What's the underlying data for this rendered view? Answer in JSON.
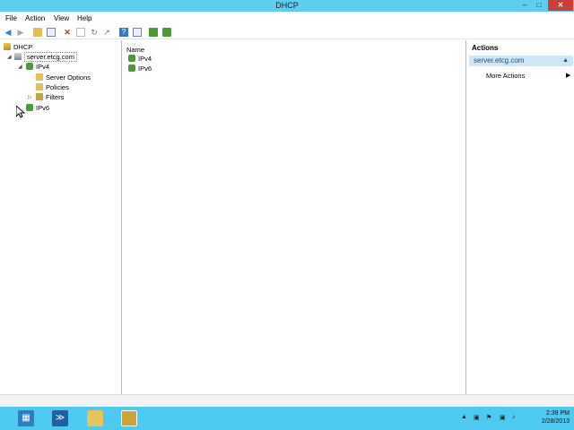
{
  "window": {
    "title": "DHCP",
    "min": "–",
    "max": "□",
    "close": "✕"
  },
  "menu": [
    "File",
    "Action",
    "View",
    "Help"
  ],
  "toolbar": {
    "icons": [
      "back-icon",
      "forward-icon",
      "up-icon",
      "show-hide-tree-icon",
      "delete-icon",
      "properties-icon",
      "refresh-icon",
      "export-icon",
      "help-icon",
      "view-icon",
      "monitor-icon",
      "network-icon"
    ]
  },
  "tree": {
    "root": "DHCP",
    "server": "server.etcg.com",
    "ipv4": "IPv4",
    "server_options": "Server Options",
    "policies": "Policies",
    "filters": "Filters",
    "ipv6": "IPv6"
  },
  "list": {
    "column_name": "Name",
    "rows": [
      "IPv4",
      "IPv6"
    ]
  },
  "actions": {
    "header": "Actions",
    "section": "server.etcg.com",
    "more": "More Actions"
  },
  "taskbar": {
    "time": "2:39 PM",
    "date": "2/28/2013"
  },
  "colors": {
    "titlebar": "#5ecdf2",
    "taskbar": "#4ec9ef",
    "selection": "#cfe6f5"
  }
}
